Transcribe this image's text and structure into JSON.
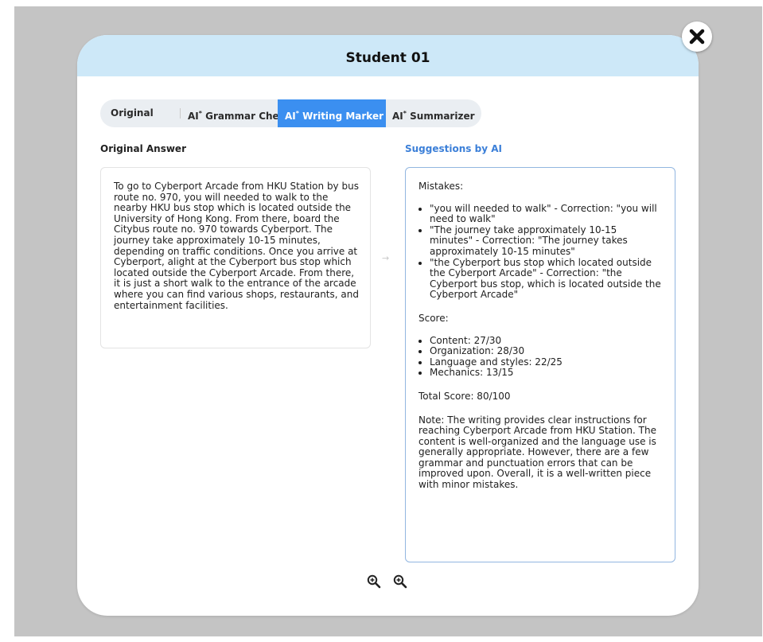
{
  "modal": {
    "title": "Student 01"
  },
  "tabs": [
    {
      "prefix": "",
      "sup": "",
      "label": "Original",
      "active": false
    },
    {
      "prefix": "AI",
      "sup": "*",
      "label": " Grammar Checker",
      "active": false
    },
    {
      "prefix": "AI",
      "sup": "*",
      "label": " Writing Marker",
      "active": true
    },
    {
      "prefix": "AI",
      "sup": "*",
      "label": " Summarizer",
      "active": false
    }
  ],
  "original": {
    "heading": "Original Answer",
    "text": "To go to Cyberport Arcade from HKU Station by bus route no. 970, you will needed to walk to the nearby HKU bus stop which is located outside the University of Hong Kong. From there, board the Citybus route no. 970 towards Cyberport. The journey take approximately 10-15 minutes, depending on traffic conditions. Once you arrive at Cyberport, alight at the Cyberport bus stop which located outside the Cyberport Arcade. From there, it is just a short walk to the entrance of the arcade where you can find various shops, restaurants, and entertainment facilities."
  },
  "suggestions": {
    "heading": "Suggestions by AI",
    "mistakes_title": "Mistakes:",
    "mistakes": [
      "\"you will needed to walk\" - Correction: \"you will need to walk\"",
      "\"The journey take approximately 10-15 minutes\" - Correction: \"The journey takes approximately 10-15 minutes\"",
      "\"the Cyberport bus stop which located outside the Cyberport Arcade\" - Correction: \"the Cyberport bus stop, which is located outside the Cyberport Arcade\""
    ],
    "score_title": "Score:",
    "scores": [
      "Content: 27/30",
      "Organization: 28/30",
      "Language and styles: 22/25",
      "Mechanics: 13/15"
    ],
    "total": "Total Score: 80/100",
    "note": "Note: The writing provides clear instructions for reaching Cyberport Arcade from HKU Station. The content is well-organized and the language use is generally appropriate. However, there are a few grammar and punctuation errors that can be improved upon. Overall, it is a well-written piece with minor mistakes."
  },
  "arrow": "→",
  "icons": {
    "close": "close-icon",
    "zoom_in": "zoom-in-icon",
    "zoom_out": "zoom-out-icon"
  },
  "colors": {
    "header_bg": "#cde8f8",
    "active_tab": "#3b8ff0",
    "ai_label": "#3b7fd8"
  }
}
